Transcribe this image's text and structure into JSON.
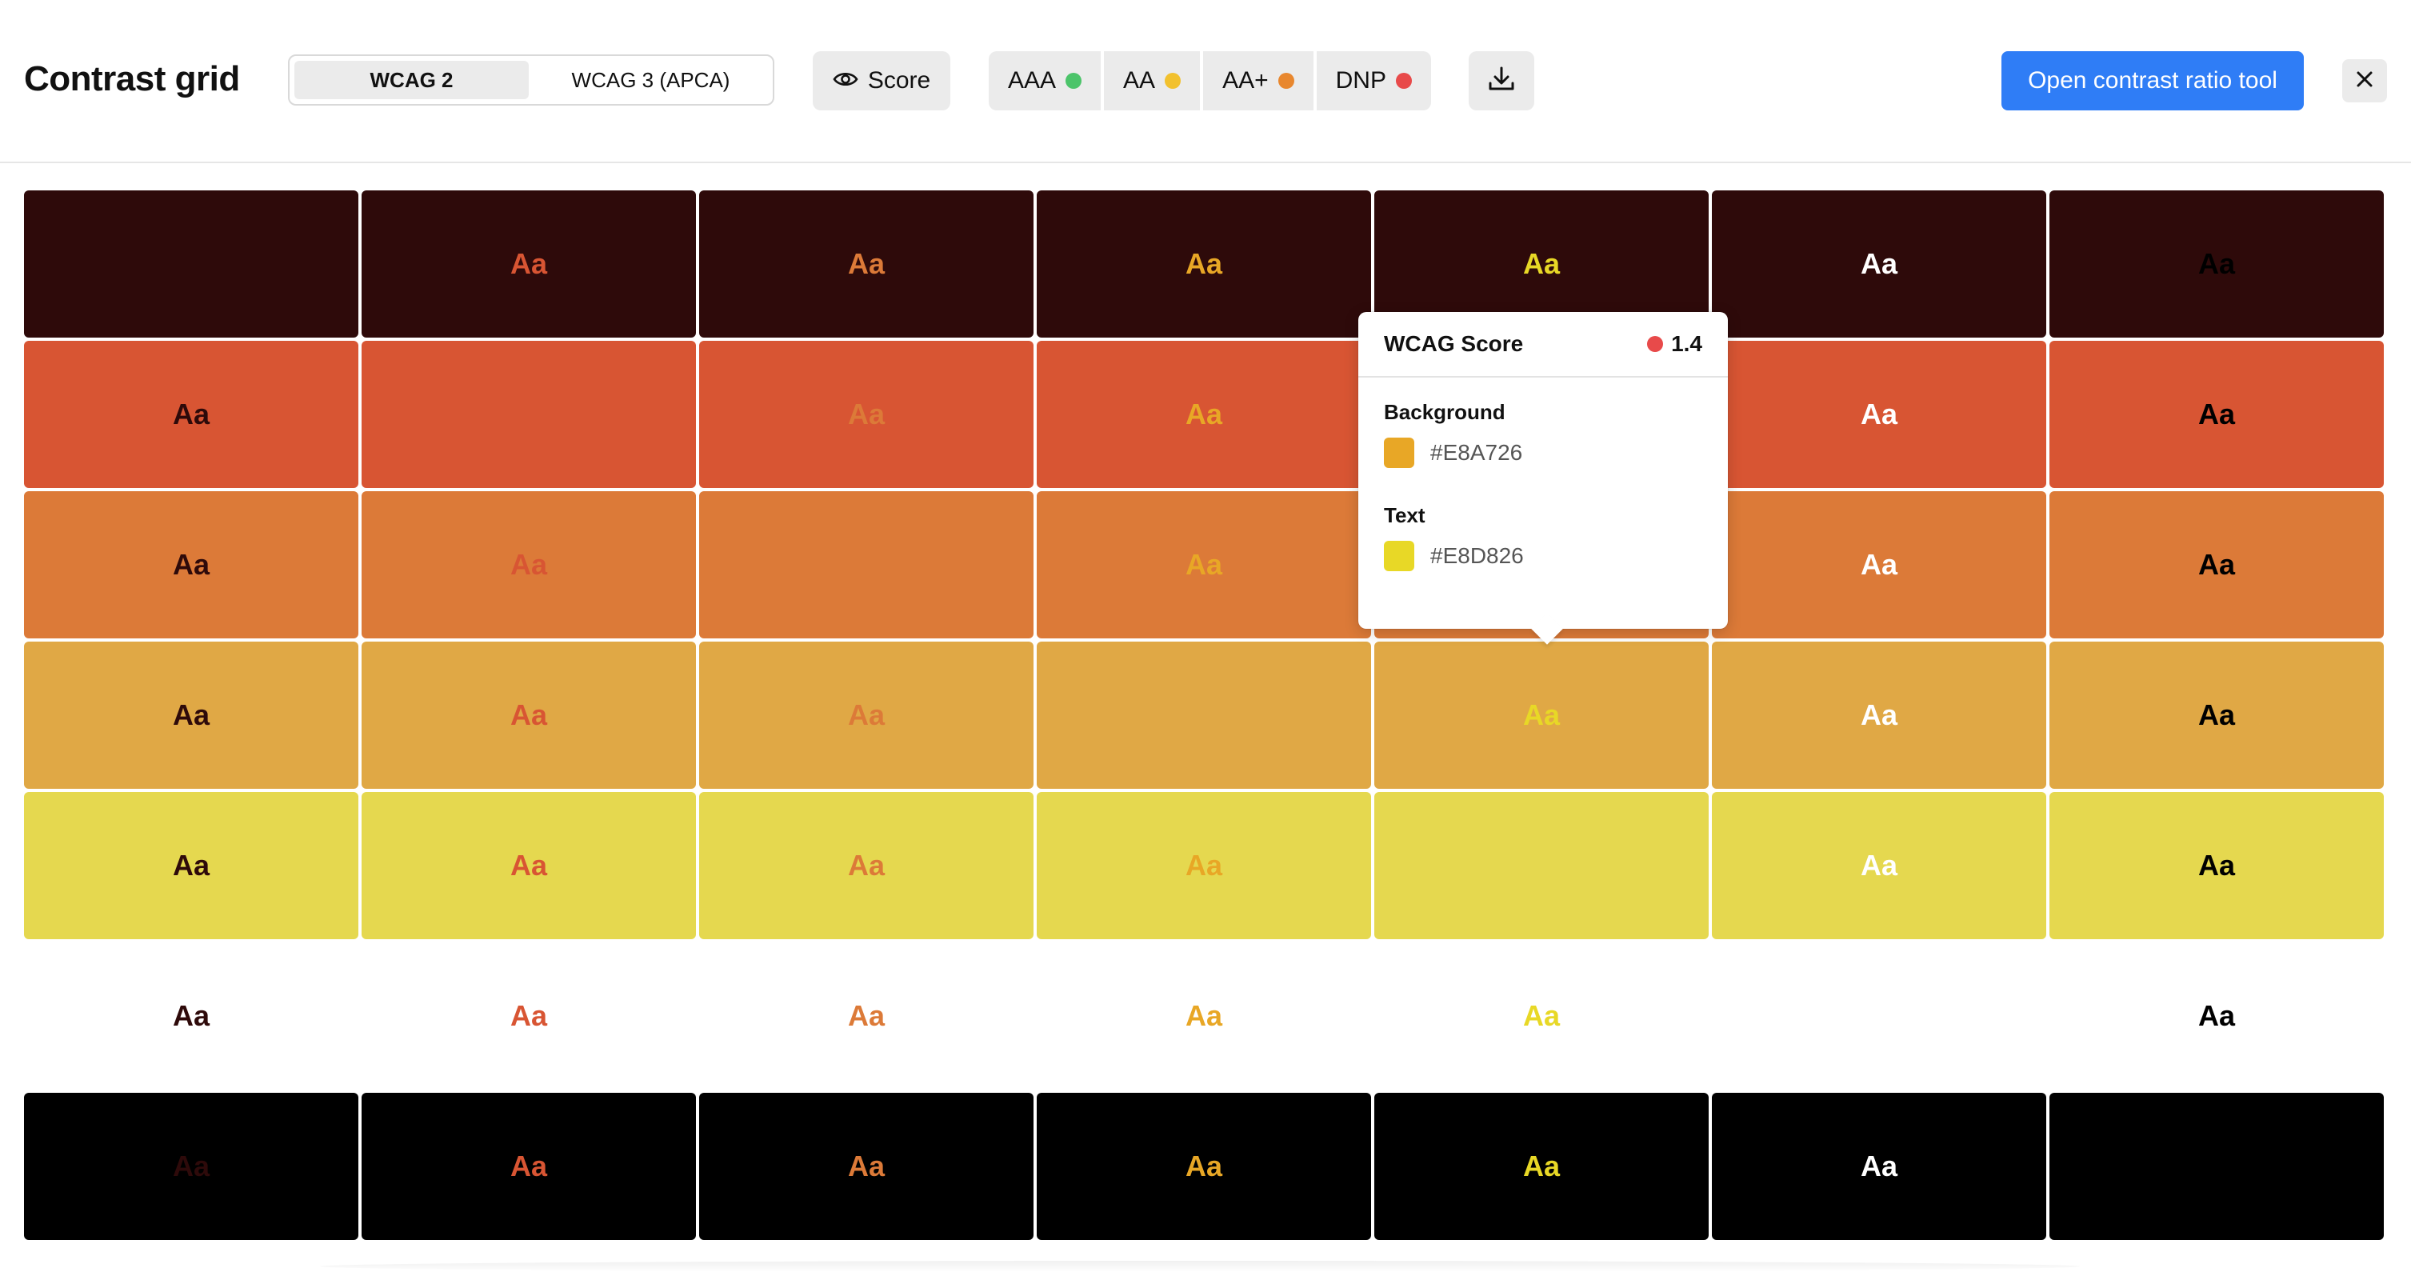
{
  "header": {
    "title": "Contrast grid",
    "modes": [
      "WCAG 2",
      "WCAG 3 (APCA)"
    ],
    "active_mode": 0,
    "score_label": "Score",
    "filters": [
      {
        "label": "AAA",
        "color": "#4cc46a"
      },
      {
        "label": "AA",
        "color": "#f2c12e"
      },
      {
        "label": "AA+",
        "color": "#e8872e"
      },
      {
        "label": "DNP",
        "color": "#e84a4a"
      }
    ],
    "open_tool_label": "Open contrast ratio tool"
  },
  "grid": {
    "sample_text": "Aa",
    "backgrounds": [
      "#2e0a0a",
      "#d85533",
      "#dc7a38",
      "#e0a845",
      "#e5d84f",
      "#ffffff",
      "#000000"
    ],
    "texts": [
      "#2e0a0a",
      "#d85533",
      "#dc7a38",
      "#e8a726",
      "#e8d826",
      "#ffffff",
      "#000000"
    ]
  },
  "tooltip": {
    "title": "WCAG Score",
    "score": "1.4",
    "score_color": "#e84a4a",
    "background_label": "Background",
    "background_hex": "#E8A726",
    "text_label": "Text",
    "text_hex": "#E8D826"
  }
}
